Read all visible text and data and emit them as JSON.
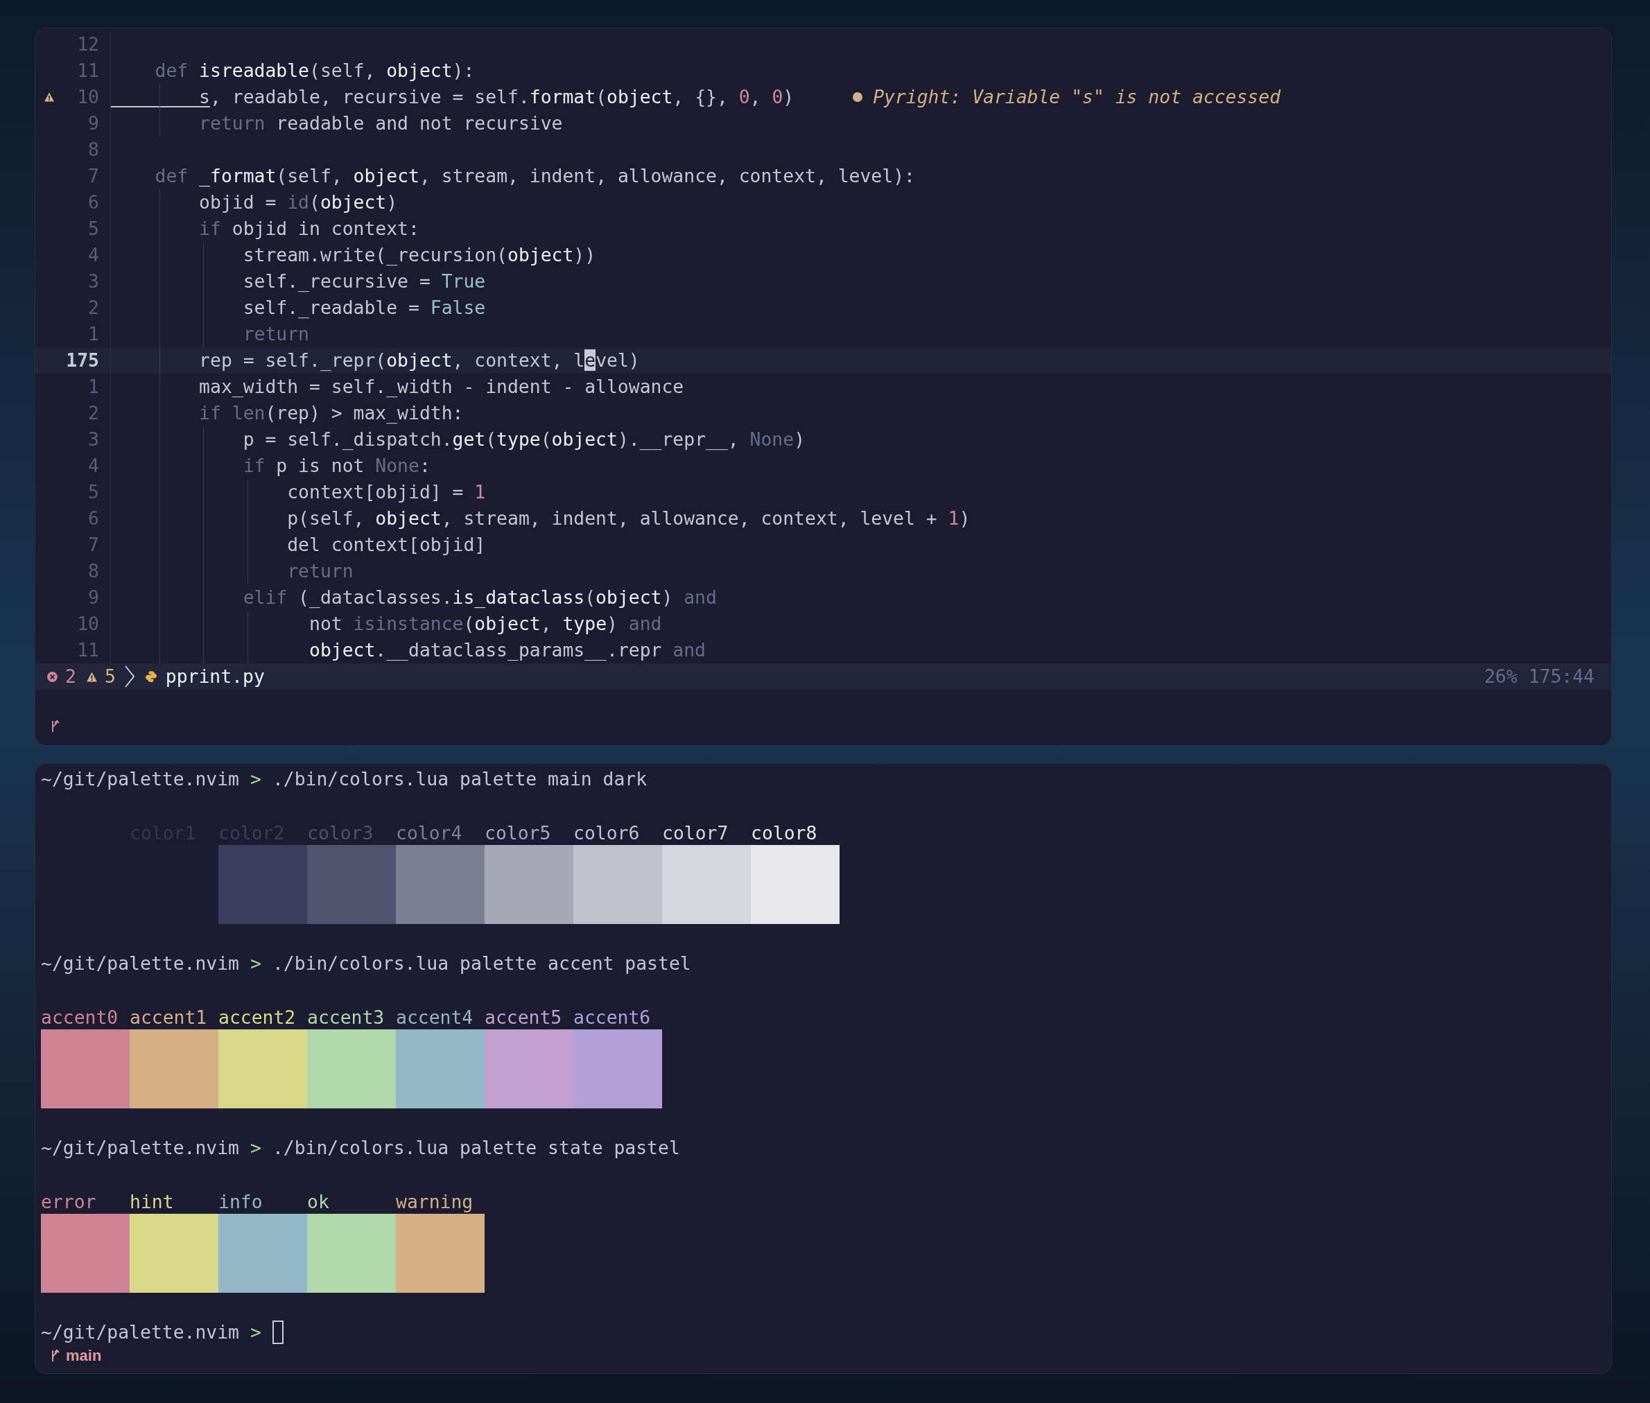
{
  "editor": {
    "lines": [
      {
        "number": "12",
        "current": false,
        "warning": false
      },
      {
        "number": "11",
        "current": false,
        "warning": false,
        "code": [
          {
            "text": "    def ",
            "kind": "kw"
          },
          {
            "text": "isreadable",
            "kind": "hl"
          },
          {
            "text": "(self, ",
            "kind": "id"
          },
          {
            "text": "object",
            "kind": "hl"
          },
          {
            "text": "):",
            "kind": "id"
          }
        ]
      },
      {
        "number": "10",
        "current": false,
        "warning": true,
        "diagnostic": "Pyright: Variable \"s\" is not accessed",
        "code": [
          {
            "text": "        s",
            "kind": "unused"
          },
          {
            "text": ", readable, recursive = self.",
            "kind": "id"
          },
          {
            "text": "format",
            "kind": "hl"
          },
          {
            "text": "(",
            "kind": "id"
          },
          {
            "text": "object",
            "kind": "hl"
          },
          {
            "text": ", {}, ",
            "kind": "id"
          },
          {
            "text": "0",
            "kind": "num"
          },
          {
            "text": ", ",
            "kind": "id"
          },
          {
            "text": "0",
            "kind": "num"
          },
          {
            "text": ")",
            "kind": "id"
          }
        ]
      },
      {
        "number": "9",
        "current": false,
        "warning": false,
        "code": [
          {
            "text": "        return",
            "kind": "kw"
          },
          {
            "text": " readable and not recursive",
            "kind": "id"
          }
        ]
      },
      {
        "number": "8",
        "current": false,
        "warning": false
      },
      {
        "number": "7",
        "current": false,
        "warning": false,
        "code": [
          {
            "text": "    def ",
            "kind": "kw"
          },
          {
            "text": "_format",
            "kind": "hl"
          },
          {
            "text": "(self, ",
            "kind": "id"
          },
          {
            "text": "object",
            "kind": "hl"
          },
          {
            "text": ", stream, indent, allowance, context, level):",
            "kind": "id"
          }
        ]
      },
      {
        "number": "6",
        "current": false,
        "warning": false,
        "code": [
          {
            "text": "        objid = ",
            "kind": "id"
          },
          {
            "text": "id",
            "kind": "kw"
          },
          {
            "text": "(",
            "kind": "id"
          },
          {
            "text": "object",
            "kind": "hl"
          },
          {
            "text": ")",
            "kind": "id"
          }
        ]
      },
      {
        "number": "5",
        "current": false,
        "warning": false,
        "code": [
          {
            "text": "        if",
            "kind": "kw"
          },
          {
            "text": " objid in context:",
            "kind": "id"
          }
        ]
      },
      {
        "number": "4",
        "current": false,
        "warning": false,
        "code": [
          {
            "text": "            stream.write(_recursion(",
            "kind": "id"
          },
          {
            "text": "object",
            "kind": "hl"
          },
          {
            "text": "))",
            "kind": "id"
          }
        ]
      },
      {
        "number": "3",
        "current": false,
        "warning": false,
        "code": [
          {
            "text": "            self._recursive = ",
            "kind": "id"
          },
          {
            "text": "True",
            "kind": "const"
          }
        ]
      },
      {
        "number": "2",
        "current": false,
        "warning": false,
        "code": [
          {
            "text": "            self._readable = ",
            "kind": "id"
          },
          {
            "text": "False",
            "kind": "const"
          }
        ]
      },
      {
        "number": "1",
        "current": false,
        "warning": false,
        "code": [
          {
            "text": "            return",
            "kind": "kw"
          }
        ]
      },
      {
        "number": "175",
        "current": true,
        "warning": false,
        "code": [
          {
            "text": "        rep = self._repr(",
            "kind": "id"
          },
          {
            "text": "object",
            "kind": "hl"
          },
          {
            "text": ", context, l",
            "kind": "id"
          },
          {
            "text": "e",
            "kind": "cursor"
          },
          {
            "text": "vel)",
            "kind": "id"
          }
        ]
      },
      {
        "number": "1",
        "current": false,
        "warning": false,
        "code": [
          {
            "text": "        max_width = self._width - indent - allowance",
            "kind": "id"
          }
        ]
      },
      {
        "number": "2",
        "current": false,
        "warning": false,
        "code": [
          {
            "text": "        if len",
            "kind": "kw"
          },
          {
            "text": "(rep) > max_width:",
            "kind": "id"
          }
        ]
      },
      {
        "number": "3",
        "current": false,
        "warning": false,
        "code": [
          {
            "text": "            p = self._dispatch.",
            "kind": "id"
          },
          {
            "text": "get",
            "kind": "hl"
          },
          {
            "text": "(",
            "kind": "id"
          },
          {
            "text": "type",
            "kind": "hl"
          },
          {
            "text": "(",
            "kind": "id"
          },
          {
            "text": "object",
            "kind": "hl"
          },
          {
            "text": ").__repr__, ",
            "kind": "id"
          },
          {
            "text": "None",
            "kind": "kw"
          },
          {
            "text": ")",
            "kind": "id"
          }
        ]
      },
      {
        "number": "4",
        "current": false,
        "warning": false,
        "code": [
          {
            "text": "            if",
            "kind": "kw"
          },
          {
            "text": " p is not ",
            "kind": "id"
          },
          {
            "text": "None",
            "kind": "kw"
          },
          {
            "text": ":",
            "kind": "id"
          }
        ]
      },
      {
        "number": "5",
        "current": false,
        "warning": false,
        "code": [
          {
            "text": "                context[objid] = ",
            "kind": "id"
          },
          {
            "text": "1",
            "kind": "num"
          }
        ]
      },
      {
        "number": "6",
        "current": false,
        "warning": false,
        "code": [
          {
            "text": "                p(self, ",
            "kind": "id"
          },
          {
            "text": "object",
            "kind": "hl"
          },
          {
            "text": ", stream, indent, allowance, context, level + ",
            "kind": "id"
          },
          {
            "text": "1",
            "kind": "num"
          },
          {
            "text": ")",
            "kind": "id"
          }
        ]
      },
      {
        "number": "7",
        "current": false,
        "warning": false,
        "code": [
          {
            "text": "                del context[objid]",
            "kind": "id"
          }
        ]
      },
      {
        "number": "8",
        "current": false,
        "warning": false,
        "code": [
          {
            "text": "                return",
            "kind": "kw"
          }
        ]
      },
      {
        "number": "9",
        "current": false,
        "warning": false,
        "code": [
          {
            "text": "            elif",
            "kind": "kw"
          },
          {
            "text": " (_dataclasses.",
            "kind": "id"
          },
          {
            "text": "is_dataclass",
            "kind": "hl"
          },
          {
            "text": "(",
            "kind": "id"
          },
          {
            "text": "object",
            "kind": "hl"
          },
          {
            "text": ") ",
            "kind": "id"
          },
          {
            "text": "and",
            "kind": "kw"
          }
        ]
      },
      {
        "number": "10",
        "current": false,
        "warning": false,
        "code": [
          {
            "text": "                  not ",
            "kind": "id"
          },
          {
            "text": "isinstance",
            "kind": "kw"
          },
          {
            "text": "(",
            "kind": "id"
          },
          {
            "text": "object",
            "kind": "hl"
          },
          {
            "text": ", ",
            "kind": "id"
          },
          {
            "text": "type",
            "kind": "hl"
          },
          {
            "text": ") ",
            "kind": "id"
          },
          {
            "text": "and",
            "kind": "kw"
          }
        ]
      },
      {
        "number": "11",
        "current": false,
        "warning": false,
        "code": [
          {
            "text": "                  object",
            "kind": "hl"
          },
          {
            "text": ".__dataclass_params__.repr ",
            "kind": "id"
          },
          {
            "text": "and",
            "kind": "kw"
          }
        ]
      }
    ],
    "status_bar": {
      "errors": "2",
      "warnings": "5",
      "file": "pprint.py",
      "progress": "26%",
      "position": "175:44"
    }
  },
  "terminal": {
    "blocks": [
      {
        "prompt": "~/git/palette.nvim",
        "symbol": ">",
        "command": "./bin/colors.lua palette main dark",
        "kind": "main",
        "swatches": [
          {
            "label": "color1",
            "color": "#1c1c36"
          },
          {
            "label": "color2",
            "color": "#3b3d5c"
          },
          {
            "label": "color3",
            "color": "#50536e"
          },
          {
            "label": "color4",
            "color": "#7c7f93"
          },
          {
            "label": "color5",
            "color": "#a6a8b6"
          },
          {
            "label": "color6",
            "color": "#c0c1cb"
          },
          {
            "label": "color7",
            "color": "#d6d7dd"
          },
          {
            "label": "color8",
            "color": "#e8e8ec"
          }
        ]
      },
      {
        "prompt": "~/git/palette.nvim",
        "symbol": ">",
        "command": "./bin/colors.lua palette accent pastel",
        "kind": "accent",
        "swatches": [
          {
            "label": "accent0",
            "color": "#cf8494"
          },
          {
            "label": "accent1",
            "color": "#d4b084"
          },
          {
            "label": "accent2",
            "color": "#d8d888"
          },
          {
            "label": "accent3",
            "color": "#b0d8ab"
          },
          {
            "label": "accent4",
            "color": "#93b8c8"
          },
          {
            "label": "accent5",
            "color": "#c4a0d0"
          },
          {
            "label": "accent6",
            "color": "#b4a0d8"
          }
        ]
      },
      {
        "prompt": "~/git/palette.nvim",
        "symbol": ">",
        "command": "./bin/colors.lua palette state pastel",
        "kind": "state",
        "swatches": [
          {
            "label": "error",
            "color": "#cf8494"
          },
          {
            "label": "hint",
            "color": "#d8d888"
          },
          {
            "label": "info",
            "color": "#93b8c8"
          },
          {
            "label": "ok",
            "color": "#b0d8ab"
          },
          {
            "label": "warning",
            "color": "#d4b084"
          }
        ]
      }
    ],
    "final_prompt": {
      "prompt": "~/git/palette.nvim",
      "symbol": ">"
    },
    "branch": "main"
  }
}
